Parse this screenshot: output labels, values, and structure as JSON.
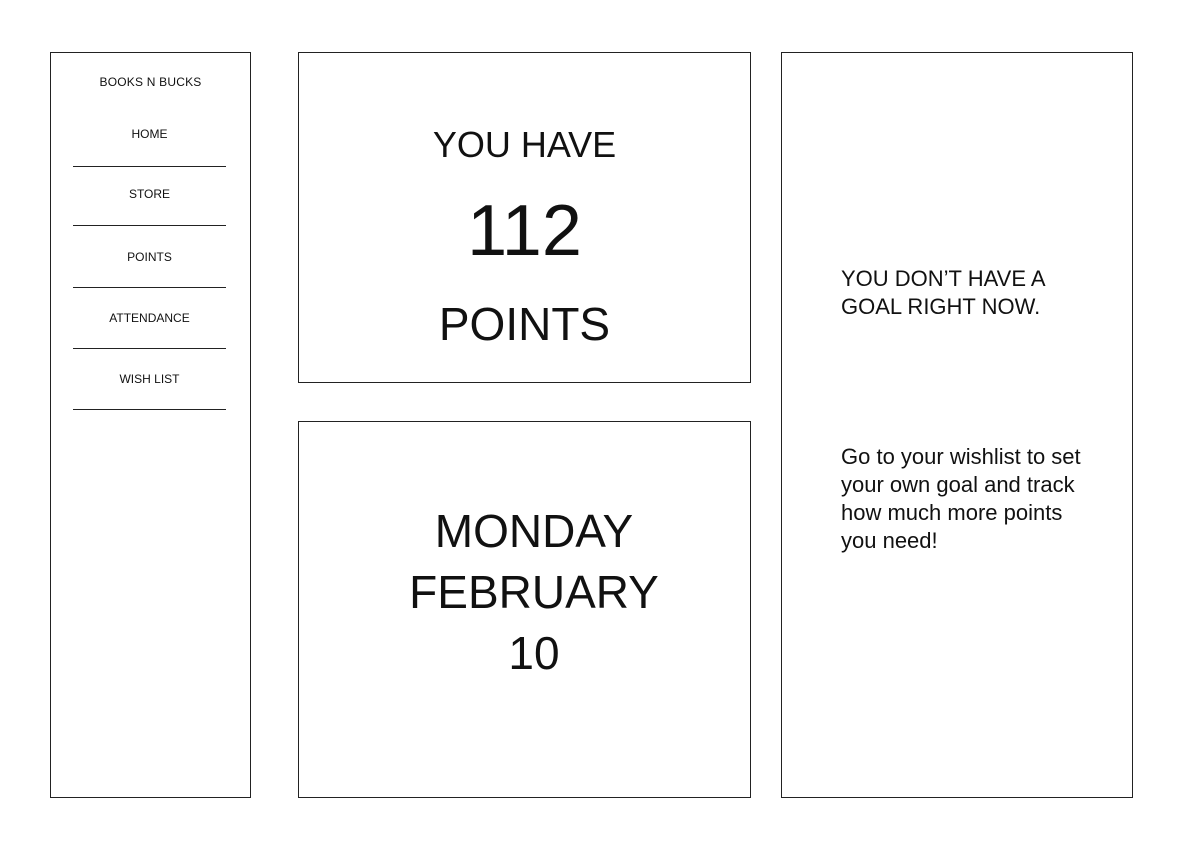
{
  "sidebar": {
    "brand": "BOOKS N BUCKS",
    "items": [
      {
        "label": "HOME"
      },
      {
        "label": "STORE"
      },
      {
        "label": "POINTS"
      },
      {
        "label": "ATTENDANCE"
      },
      {
        "label": "WISH LIST"
      }
    ]
  },
  "points": {
    "prefix": "YOU HAVE",
    "value": "112",
    "suffix": "POINTS"
  },
  "date": {
    "weekday": "MONDAY",
    "month": "FEBRUARY",
    "day": "10"
  },
  "goal": {
    "title": "YOU DON’T HAVE A GOAL RIGHT NOW.",
    "message": "Go to your wishlist to set your own goal and track how much more points you need!"
  }
}
